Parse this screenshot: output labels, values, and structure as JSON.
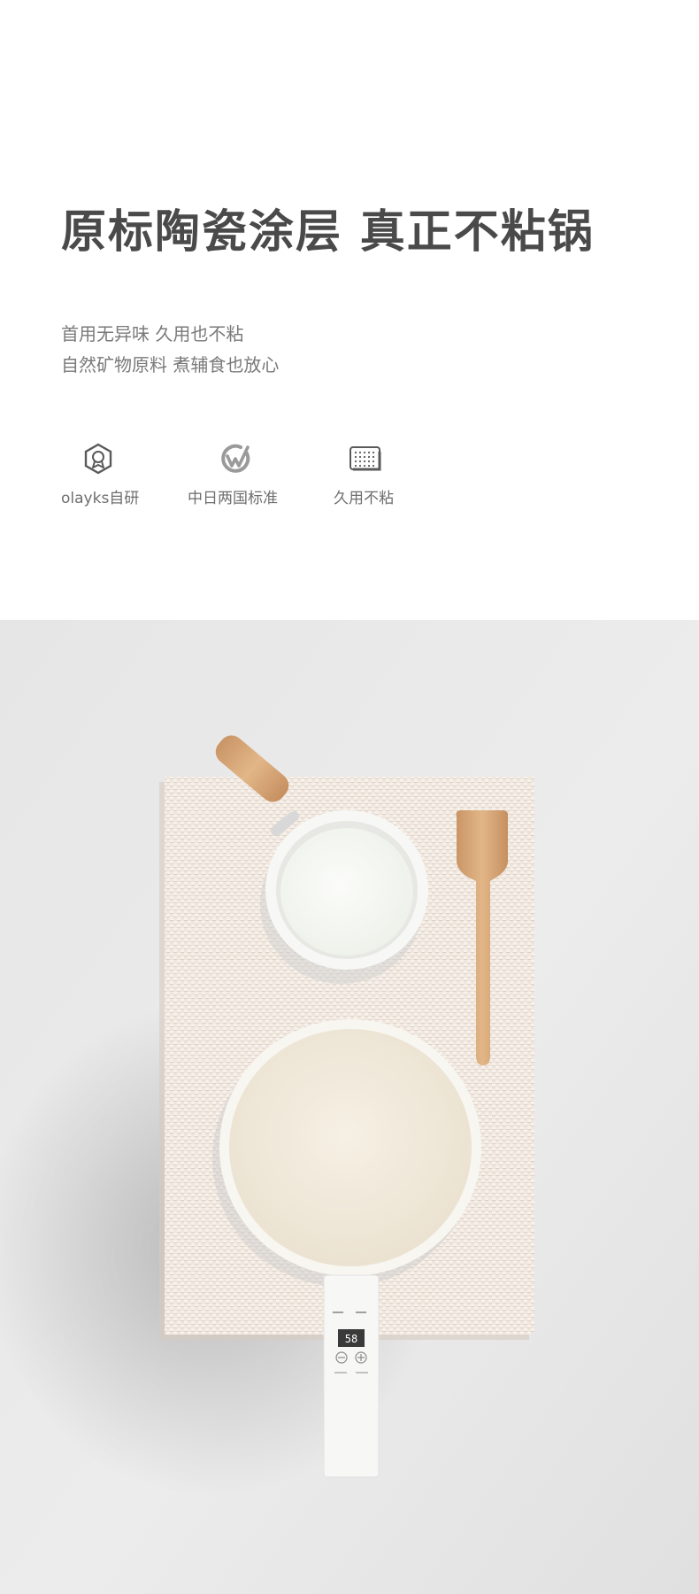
{
  "headline": "原标陶瓷涂层 真正不粘锅",
  "subtitle": {
    "line1": "首用无异味 久用也不粘",
    "line2": "自然矿物原料 煮辅食也放心"
  },
  "features": [
    {
      "icon": "certified-badge-icon",
      "label": "olayks自研"
    },
    {
      "icon": "standard-check-icon",
      "label": "中日两国标准"
    },
    {
      "icon": "coating-grid-icon",
      "label": "久用不粘"
    }
  ],
  "control_panel": {
    "display": "58",
    "buttons": [
      {
        "icon": "minus-icon"
      },
      {
        "icon": "plus-icon"
      }
    ]
  },
  "colors": {
    "headline": "#4a4a4a",
    "subtitle": "#7a7a7a",
    "feature_label": "#6e6e6e",
    "icon_stroke": "#5a5a5a",
    "wood": "#d9ab7a",
    "pan_interior": "#f3ecde"
  }
}
